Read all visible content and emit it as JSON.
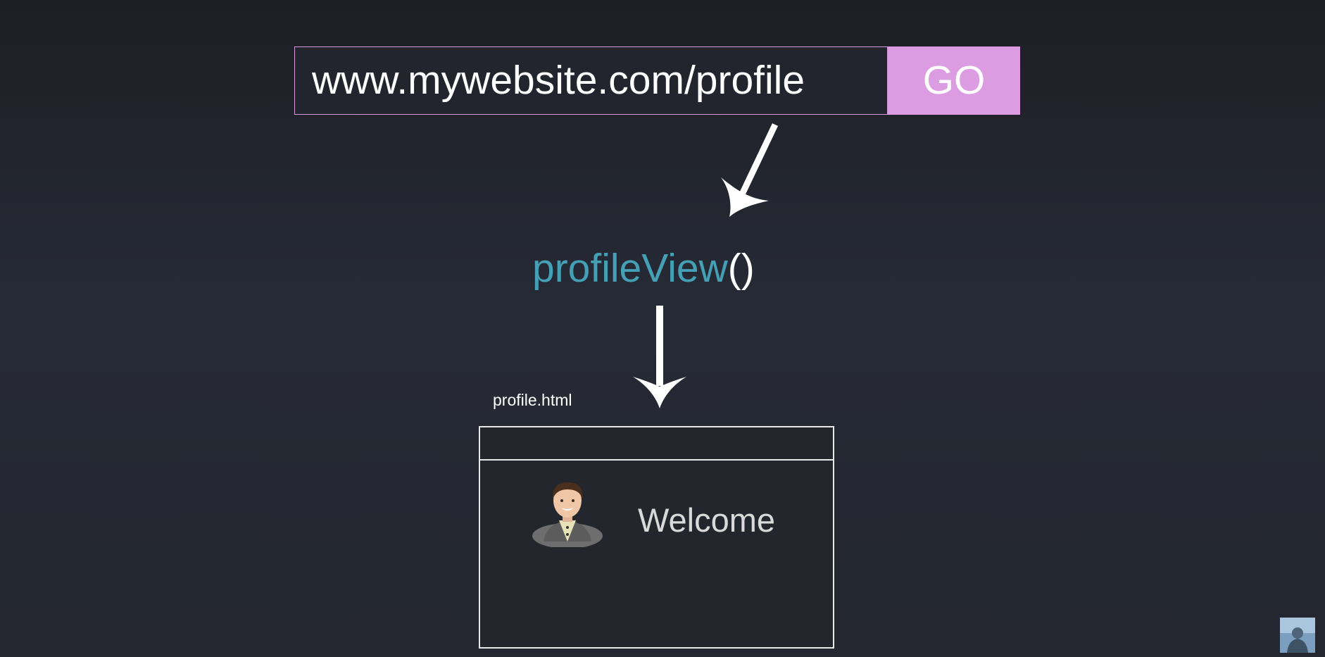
{
  "url_bar": {
    "url": "www.mywebsite.com/profile",
    "go_label": "GO"
  },
  "view_function": {
    "name": "profileView",
    "parens": "()"
  },
  "template": {
    "file_label": "profile.html",
    "welcome_text": "Welcome"
  },
  "icons": {
    "arrow_1": "arrow-down-left-icon",
    "arrow_2": "arrow-down-icon",
    "avatar": "user-avatar-icon",
    "thumbnail": "presenter-thumbnail"
  },
  "colors": {
    "url_border": "#d797dc",
    "go_button": "#dc9ce2",
    "function_name": "#45a0b5",
    "background": "#262a35"
  }
}
